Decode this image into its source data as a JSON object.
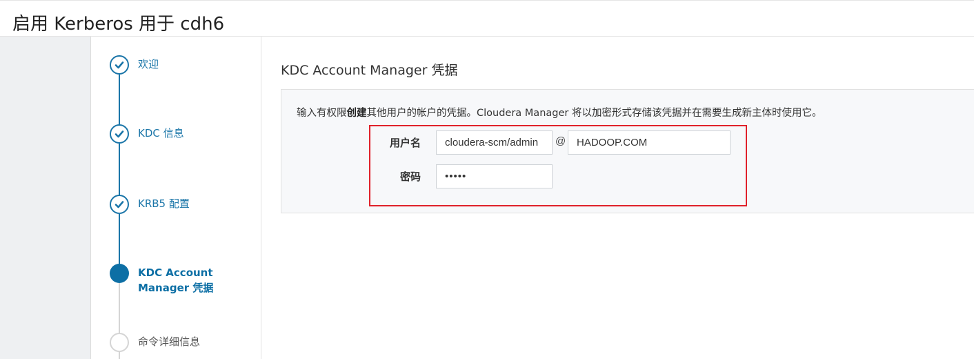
{
  "page": {
    "title": "启用 Kerberos 用于 cdh6"
  },
  "steps": [
    {
      "label": "欢迎",
      "state": "done"
    },
    {
      "label": "KDC 信息",
      "state": "done"
    },
    {
      "label": "KRB5 配置",
      "state": "done"
    },
    {
      "label_line1": "KDC Account",
      "label_line2": "Manager 凭据",
      "state": "current"
    },
    {
      "label": "命令详细信息",
      "state": "pending"
    }
  ],
  "section": {
    "title": "KDC Account Manager 凭据",
    "desc_before": "输入有权限",
    "desc_bold": "创建",
    "desc_after": "其他用户的帐户的凭据。Cloudera Manager 将以加密形式存储该凭据并在需要生成新主体时使用它。"
  },
  "form": {
    "username_label": "用户名",
    "username_value": "cloudera-scm/admin",
    "at": "@",
    "realm_value": "HADOOP.COM",
    "password_label": "密码",
    "password_value": "•••••"
  },
  "colors": {
    "accent": "#1a75a8",
    "highlight": "#e0212a"
  },
  "icons": {
    "step_done": "checkmark-icon"
  }
}
